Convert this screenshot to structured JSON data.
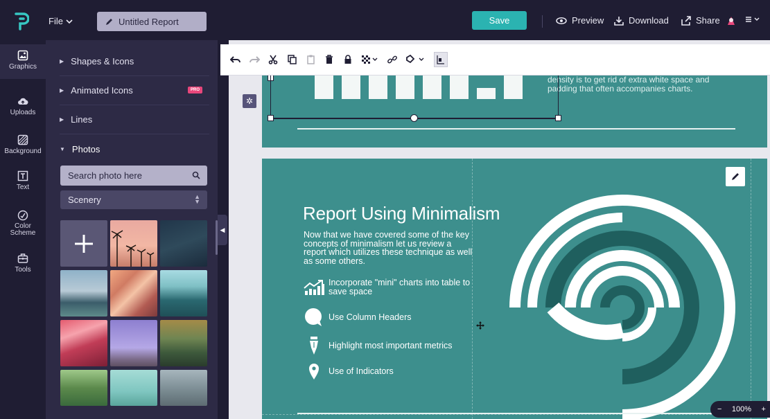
{
  "topbar": {
    "file_label": "File",
    "report_title": "Untitled Report",
    "save_label": "Save",
    "preview_label": "Preview",
    "download_label": "Download",
    "share_label": "Share"
  },
  "rail": {
    "items": [
      {
        "label": "Graphics",
        "icon": "image-icon"
      },
      {
        "label": "Uploads",
        "icon": "cloud-upload-icon"
      },
      {
        "label": "Background",
        "icon": "background-pattern-icon"
      },
      {
        "label": "Text",
        "icon": "text-icon"
      },
      {
        "label": "Color Scheme",
        "icon": "palette-icon"
      },
      {
        "label": "Tools",
        "icon": "toolbox-icon"
      }
    ]
  },
  "panel": {
    "sections": [
      {
        "label": "Shapes & Icons"
      },
      {
        "label": "Animated Icons",
        "badge": "PRO"
      },
      {
        "label": "Lines"
      },
      {
        "label": "Photos"
      }
    ],
    "search_placeholder": "Search photo here",
    "category_selected": "Scenery"
  },
  "page1": {
    "caption": "density is to get rid of extra white space and padding that often accompanies charts."
  },
  "page2": {
    "title": "Report Using Minimalism",
    "body": "Now that we have covered some of the key concepts of minimalism let us review a report which utilizes these technique as well as some others.",
    "bullets": [
      {
        "text": "Incorporate \"mini\" charts into table to save space",
        "icon": "chart-trend-icon"
      },
      {
        "text": "Use Column Headers",
        "icon": "speech-bubble-icon"
      },
      {
        "text": "Highlight most important metrics",
        "icon": "pen-nib-icon"
      },
      {
        "text": "Use of Indicators",
        "icon": "map-pin-icon"
      }
    ]
  },
  "zoom": {
    "minus": "−",
    "value": "100%",
    "plus": "+"
  },
  "colors": {
    "accent": "#2bb3b1",
    "slide_teal": "#3d8f8d",
    "dark_bg": "#1f1d33",
    "panel_bg": "#2d2a45",
    "pro_badge": "#e8477b"
  }
}
